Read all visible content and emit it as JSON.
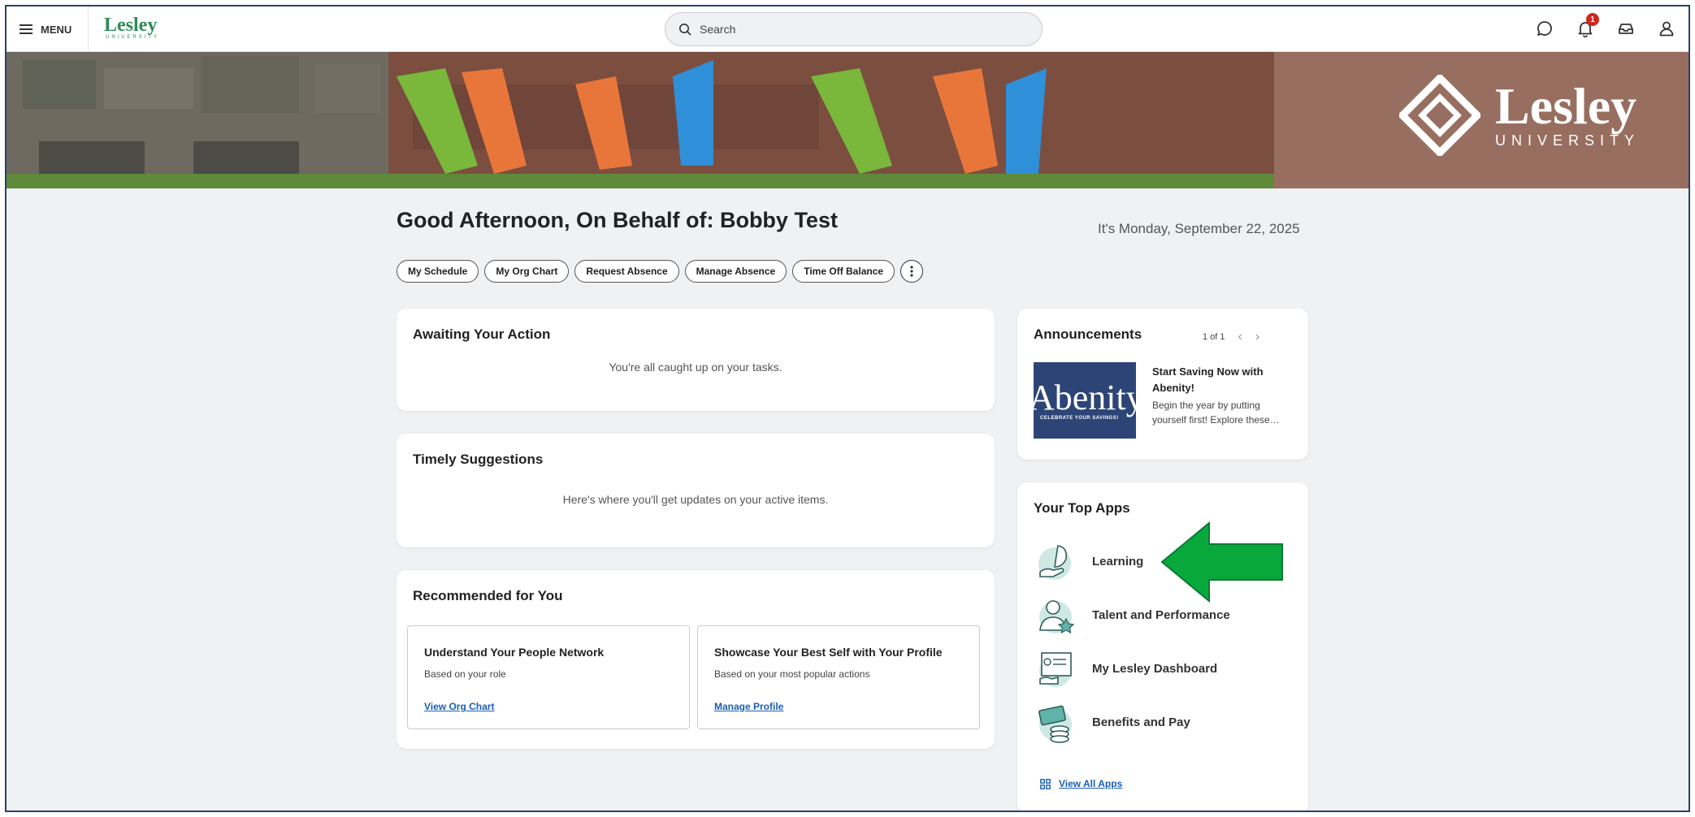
{
  "topbar": {
    "menu_label": "MENU",
    "brand_name": "Lesley",
    "brand_sub": "UNIVERSITY",
    "search_placeholder": "Search",
    "notification_count": "1"
  },
  "banner": {
    "logo_word": "Lesley",
    "logo_sub": "UNIVERSITY"
  },
  "greeting": "Good Afternoon, On Behalf of: Bobby Test",
  "date": "It's Monday, September 22, 2025",
  "quick_actions": [
    "My Schedule",
    "My Org Chart",
    "Request Absence",
    "Manage Absence",
    "Time Off Balance"
  ],
  "awaiting": {
    "title": "Awaiting Your Action",
    "message": "You're all caught up on your tasks."
  },
  "timely": {
    "title": "Timely Suggestions",
    "message": "Here's where you'll get updates on your active items."
  },
  "recommended": {
    "title": "Recommended for You",
    "items": [
      {
        "title": "Understand Your People Network",
        "subtitle": "Based on your role",
        "link": "View Org Chart"
      },
      {
        "title": "Showcase Your Best Self with Your Profile",
        "subtitle": "Based on your most popular actions",
        "link": "Manage Profile"
      }
    ]
  },
  "announcements": {
    "title": "Announcements",
    "pager": "1 of 1",
    "image_word": "Abenity",
    "image_caption": "CELEBRATE YOUR SAVINGS!",
    "item_title": "Start Saving Now with Abenity!",
    "item_body": "Begin the year by putting yourself first! Explore these…"
  },
  "top_apps": {
    "title": "Your Top Apps",
    "apps": [
      {
        "label": "Learning",
        "icon": "learning-icon"
      },
      {
        "label": "Talent and Performance",
        "icon": "talent-icon"
      },
      {
        "label": "My Lesley Dashboard",
        "icon": "dashboard-icon"
      },
      {
        "label": "Benefits and Pay",
        "icon": "benefits-icon"
      }
    ],
    "view_all": "View All Apps"
  },
  "colors": {
    "brand_green": "#2e8b57",
    "link_blue": "#1a5fb4",
    "badge_red": "#d0271d",
    "annotation_arrow": "#09a83d",
    "frame_border": "#2b3f6b"
  }
}
